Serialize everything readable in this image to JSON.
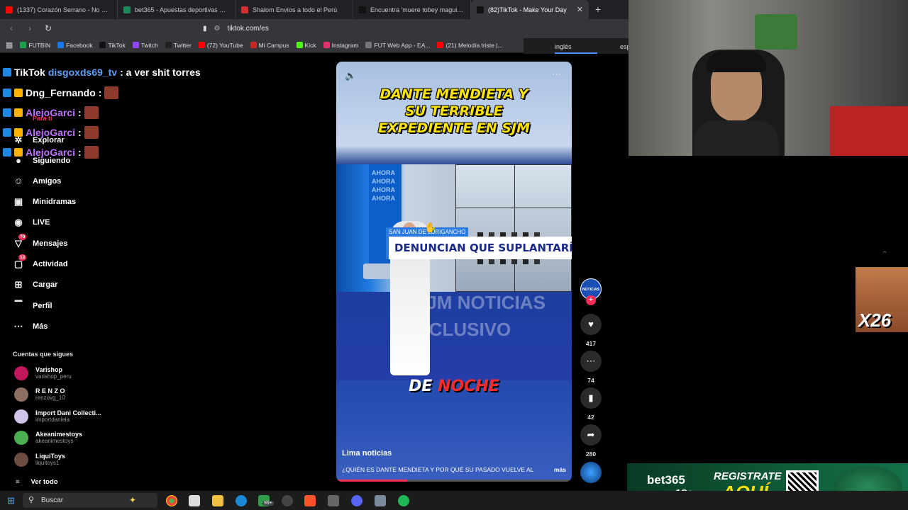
{
  "browser": {
    "tabs": [
      {
        "label": "(1337) Corazón Serrano - No Eres Ún",
        "color": "#ff0000",
        "active": false
      },
      {
        "label": "bet365 - Apuestas deportivas en la r",
        "color": "#1b8a5a",
        "active": false
      },
      {
        "label": "Shalom Envíos a todo el Perú",
        "color": "#d32f2f",
        "active": false
      },
      {
        "label": "Encuentra 'muere tobey maguire' en",
        "color": "#111111",
        "active": false
      },
      {
        "label": "(82)TikTok - Make Your Day",
        "color": "#111111",
        "active": true
      }
    ],
    "new_tab": "+",
    "close": "✕",
    "url": "tiktok.com/es",
    "bookmarks": [
      {
        "label": "FUTBIN",
        "color": "#1aa34a"
      },
      {
        "label": "Facebook",
        "color": "#1877f2"
      },
      {
        "label": "TikTok",
        "color": "#111111"
      },
      {
        "label": "Twitch",
        "color": "#9146ff"
      },
      {
        "label": "Twitter",
        "color": "#222222"
      },
      {
        "label": "(72) YouTube",
        "color": "#ff0000"
      },
      {
        "label": "Mi Campus",
        "color": "#c62828"
      },
      {
        "label": "Kick",
        "color": "#53fc18"
      },
      {
        "label": "Instagram",
        "color": "#e1306c"
      },
      {
        "label": "FUT Web App - EA...",
        "color": "#777777"
      },
      {
        "label": "(21) Melodía triste |...",
        "color": "#ff0000"
      }
    ],
    "lang_options": [
      "inglés",
      "esp"
    ]
  },
  "chat": [
    {
      "user": "TikTok",
      "extra": "disgoxds69_tv",
      "message": ": a ver shit torres",
      "color": "#5aa0ff"
    },
    {
      "user": "Dng_Fernando",
      "message": ":",
      "color": "#ffffff"
    },
    {
      "user": "AlejoGarci",
      "message": ":",
      "color": "#c070ff",
      "sub": "Para ti"
    },
    {
      "user": "AlejoGarci",
      "message": ":",
      "color": "#c070ff"
    },
    {
      "user": "AlejoGarci",
      "message": ":",
      "color": "#c070ff"
    }
  ],
  "sidebar": {
    "items": [
      {
        "label": "Explorar",
        "icon": "compass-icon"
      },
      {
        "label": "Siguiendo",
        "icon": "following-avatar-icon"
      },
      {
        "label": "Amigos",
        "icon": "friends-icon"
      },
      {
        "label": "Minidramas",
        "icon": "film-icon"
      },
      {
        "label": "LIVE",
        "icon": "live-icon"
      },
      {
        "label": "Mensajes",
        "icon": "messages-icon",
        "badge": "70"
      },
      {
        "label": "Actividad",
        "icon": "activity-icon",
        "badge": "12"
      },
      {
        "label": "Cargar",
        "icon": "upload-icon"
      },
      {
        "label": "Perfil",
        "icon": "profile-icon"
      },
      {
        "label": "Más",
        "icon": "more-icon"
      }
    ],
    "following_title": "Cuentas que sigues",
    "following": [
      {
        "name": "Varishop",
        "handle": "varishop_peru",
        "color": "#c2185b"
      },
      {
        "name": "R E N Z O",
        "handle": "renzovg_10",
        "color": "#8d6e63"
      },
      {
        "name": "Import Dani Collecti...",
        "handle": "importdaniela",
        "color": "#d1c4e9"
      },
      {
        "name": "Akeanimestoys",
        "handle": "akeanimestoys",
        "color": "#4caf50"
      },
      {
        "name": "LiquiToys",
        "handle": "liquitoys1",
        "color": "#6d4c41"
      }
    ],
    "see_all": "Ver todo"
  },
  "video": {
    "headline": [
      "DANTE MENDIETA Y",
      "SU TERRIBLE",
      "EXPEDIENTE EN SJM"
    ],
    "kicker": "SAN JUAN DE LURIGANCHO",
    "lower_third": "DENUNCIAN QUE SUPLANTARÍA",
    "bg_text_1": "SJM NOTICIAS",
    "bg_text_2": "EXCLUSIVO",
    "ahora": "AHORA",
    "caption_white": "DE ",
    "caption_red": "NOCHE",
    "author": "Lima noticias",
    "description": "¿QUIÉN ES DANTE MENDIETA Y POR QUÉ SU PASADO VUELVE AL",
    "more": "más",
    "progress": 0.3
  },
  "actions": {
    "avatar_label": "NOTICIAS",
    "likes": "417",
    "comments": "74",
    "saves": "42",
    "shares": "280"
  },
  "overlay": {
    "multiplier": "x26",
    "ad_brand": "bet365",
    "ad_age": "18+",
    "ad_cta_1": "REGISTRATE",
    "ad_cta_2": "AQUÍ"
  },
  "taskbar": {
    "search_placeholder": "Buscar",
    "badge": "99+"
  }
}
